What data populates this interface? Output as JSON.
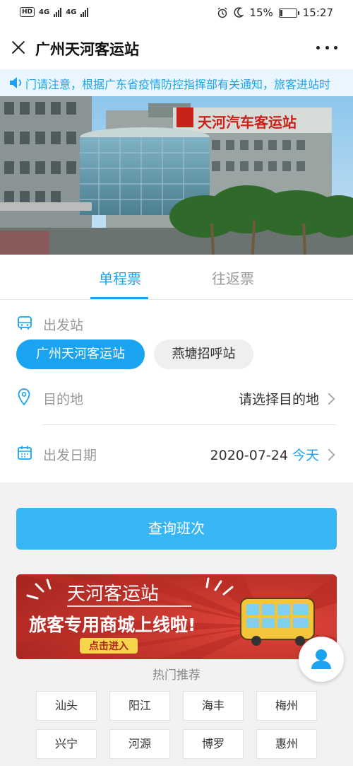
{
  "status_bar": {
    "left_badges": [
      "HD",
      "4G",
      "4G"
    ],
    "battery": "15%",
    "battery_level": 0.15,
    "time": "15:27"
  },
  "header": {
    "title": "广州天河客运站",
    "close_icon": "close-icon",
    "more_icon": "more-icon"
  },
  "notice": {
    "icon": "speaker-icon",
    "text": "门请注意，根据广东省疫情防控指挥部有关通知，旅客进站时"
  },
  "banner": {
    "building_sign": "天河汽车客运站"
  },
  "tabs": [
    {
      "label": "单程票",
      "active": true
    },
    {
      "label": "往返票",
      "active": false
    }
  ],
  "form": {
    "departure": {
      "icon": "bus-icon",
      "label": "出发站",
      "options": [
        {
          "label": "广州天河客运站",
          "selected": true
        },
        {
          "label": "燕塘招呼站",
          "selected": false
        }
      ]
    },
    "destination": {
      "icon": "location-pin-icon",
      "label": "目的地",
      "value": "请选择目的地"
    },
    "date": {
      "icon": "calendar-icon",
      "label": "出发日期",
      "value": "2020-07-24",
      "today": "今天"
    }
  },
  "search_button": {
    "label": "查询班次"
  },
  "promo": {
    "title": "天河客运站",
    "subtitle": "旅客专用商城上线啦!",
    "cta": "点击进入"
  },
  "hot": {
    "title": "热门推荐",
    "cities": [
      "汕头",
      "阳江",
      "海丰",
      "梅州",
      "兴宁",
      "河源",
      "博罗",
      "惠州"
    ]
  },
  "colors": {
    "accent": "#1aa3f0",
    "search_button": "#37b6f6",
    "promo_red": "#c8312b"
  }
}
